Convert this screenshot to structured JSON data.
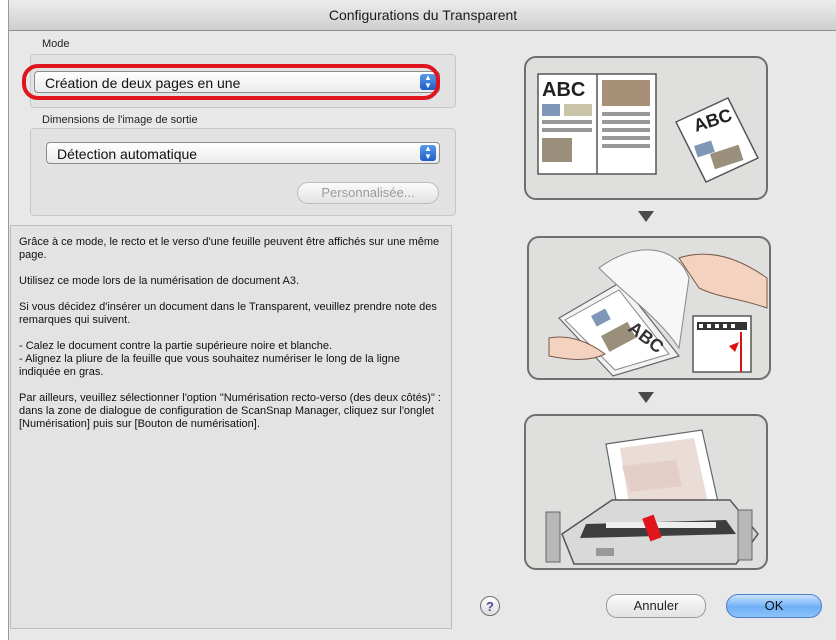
{
  "window": {
    "title": "Configurations du Transparent"
  },
  "mode": {
    "label": "Mode",
    "selected": "Création de deux pages en une"
  },
  "output_size": {
    "label": "Dimensions de l'image de sortie",
    "selected": "Détection automatique",
    "custom_button": "Personnalisée..."
  },
  "description": {
    "p1": "Grâce à ce mode, le recto et le verso d'une feuille peuvent être affichés sur une même page.",
    "p2": "Utilisez ce mode lors de la numérisation de document A3.",
    "p3": "Si vous décidez d'insérer un document dans le Transparent, veuillez prendre note des remarques qui suivent.",
    "p4a": "- Calez le document contre la partie supérieure noire et blanche.",
    "p4b": "- Alignez la pliure de la feuille que vous souhaitez numériser le long de la ligne indiquée en gras.",
    "p5": "Par ailleurs, veuillez sélectionner l'option \"Numérisation recto-verso (des deux côtés)\" : dans la zone de dialogue de configuration de ScanSnap Manager, cliquez sur l'onglet [Numérisation] puis sur [Bouton de numérisation]."
  },
  "illustration": {
    "abc_text_1": "ABC",
    "abc_text_2": "ABC",
    "abc_text_3": "ABC"
  },
  "buttons": {
    "help": "?",
    "cancel": "Annuler",
    "ok": "OK"
  },
  "colors": {
    "highlight": "#e0141c",
    "default_button": "#6fb0f6"
  }
}
